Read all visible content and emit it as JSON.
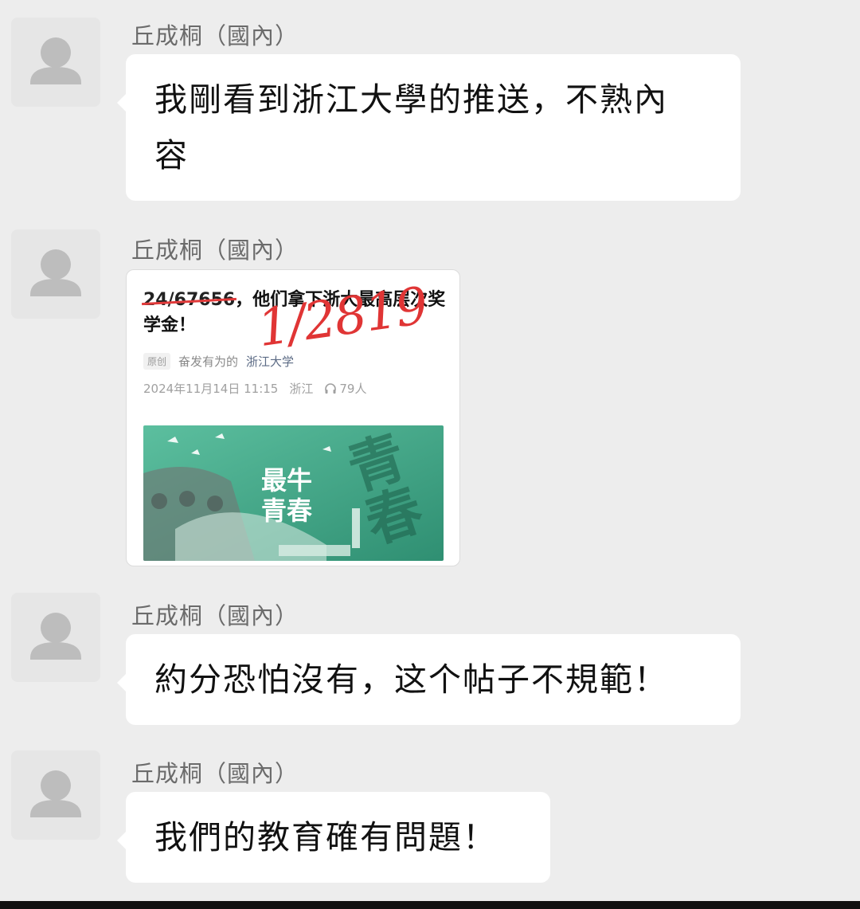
{
  "messages": [
    {
      "sender": "丘成桐（國內）",
      "lines": [
        "我剛看到浙江大學的推送，不熟內",
        "容"
      ]
    },
    {
      "sender": "丘成桐（國內）",
      "type": "article"
    },
    {
      "sender": "丘成桐（國內）",
      "lines": [
        "約分恐怕沒有，这个帖子不規範！"
      ]
    },
    {
      "sender": "丘成桐（國內）",
      "lines": [
        "我們的教育確有問題！"
      ]
    }
  ],
  "article": {
    "title_strike": "24/67656",
    "title_rest": "，他们拿下浙大最高层次奖学金！",
    "handwritten": "1/2819",
    "tag": "原创",
    "author": "奋发有为的",
    "account": "浙江大学",
    "date": "2024年11月14日 11:15",
    "location": "浙江",
    "listeners": "79人",
    "cover_text_line1": "最牛",
    "cover_text_line2": "青春",
    "cover_big_text": "青春"
  },
  "colors": {
    "background": "#ededed",
    "bubble": "#ffffff",
    "cover_green": "#3fa88a",
    "handwriting_red": "#e03535"
  },
  "icons": {
    "avatar": "default-user-avatar-icon",
    "headphone": "headphone-icon"
  }
}
